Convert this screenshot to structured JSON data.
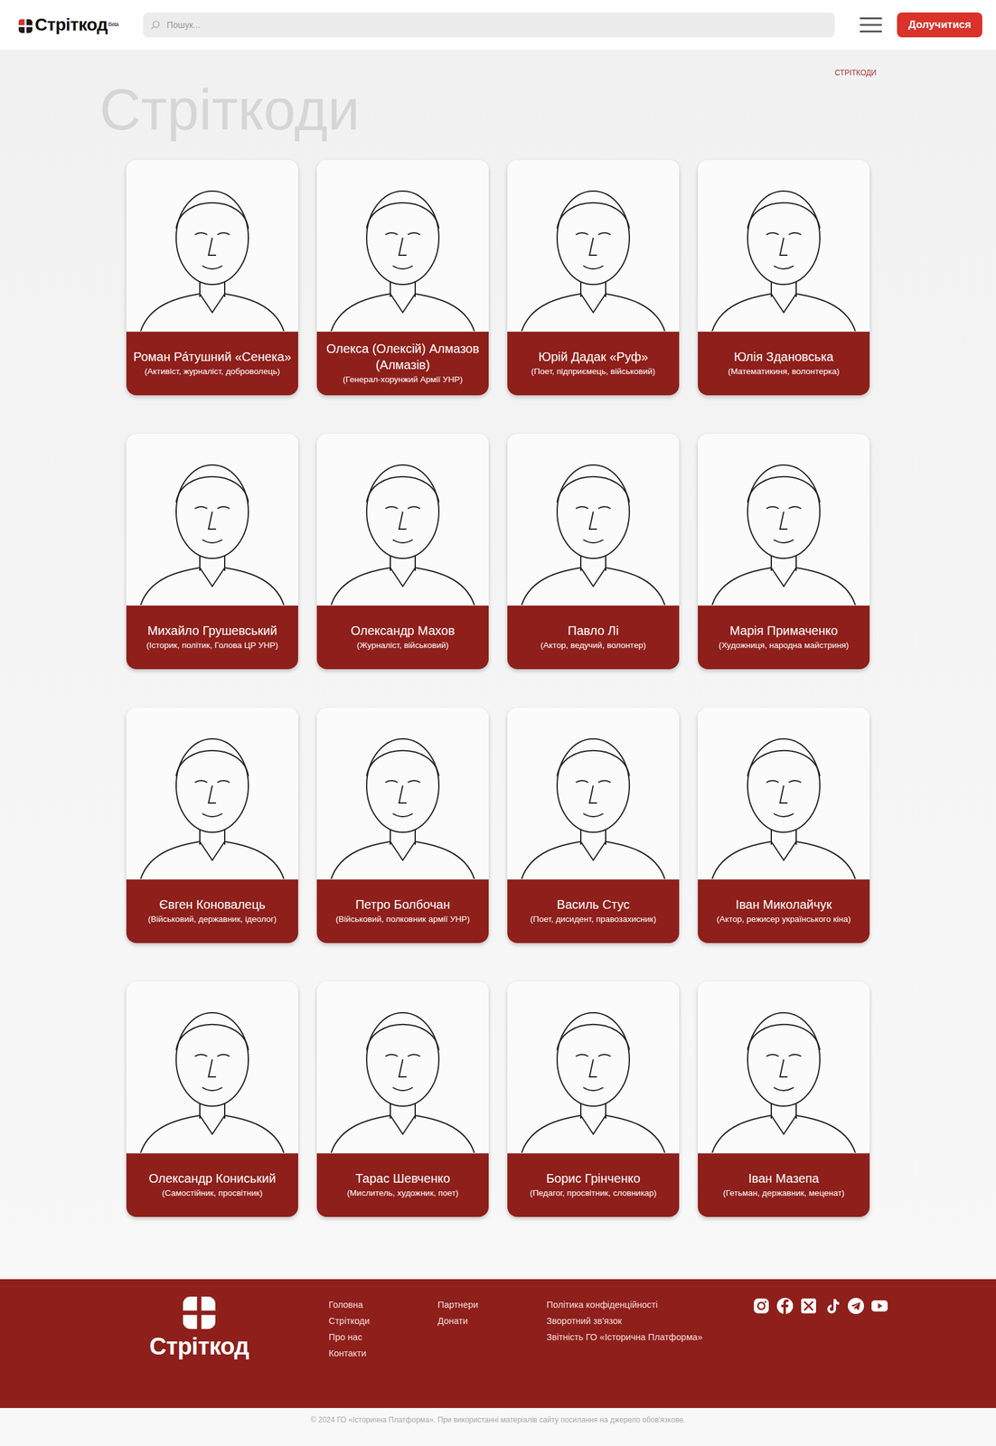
{
  "header": {
    "logo": "Стріткод",
    "beta": "Beta",
    "search": {
      "placeholder": "Пошук..."
    },
    "join_button": "Долучитися"
  },
  "breadcrumb": "СТРІТКОДИ",
  "title": "Стріткоди",
  "cards": [
    {
      "name": "Роман Ра́тушний «Сенека»",
      "role": "(Активіст, журналіст, доброволець)"
    },
    {
      "name": "Олекса (Олексій) Алмазов (Алмазів)",
      "role": "(Генерал-хорунжий Армії УНР)"
    },
    {
      "name": "Юрій Дадак «Руф»",
      "role": "(Поет, підприємець, військовий)"
    },
    {
      "name": "Юлія Здановська",
      "role": "(Математикиня, волонтерка)"
    },
    {
      "name": "Михайло Грушевський",
      "role": "(Історик, політик, Голова ЦР УНР)"
    },
    {
      "name": "Олександр Махов",
      "role": "(Журналіст, військовий)"
    },
    {
      "name": "Павло Лі",
      "role": "(Актор, ведучий, волонтер)"
    },
    {
      "name": "Марія Примаченко",
      "role": "(Художниця, народна майстриня)"
    },
    {
      "name": "Євген Коновалець",
      "role": "(Військовий, державник, ідеолог)"
    },
    {
      "name": "Петро Болбочан",
      "role": "(Військовий, полковник армії УНР)"
    },
    {
      "name": "Василь Стус",
      "role": "(Поет, дисидент, правозахисник)"
    },
    {
      "name": "Іван Миколайчук",
      "role": "(Актор, режисер українського кіна)"
    },
    {
      "name": "Олександр Кониський",
      "role": "(Самостійник, просвітник)"
    },
    {
      "name": "Тарас Шевченко",
      "role": "(Мислитель, художник, поет)"
    },
    {
      "name": "Борис Грінченко",
      "role": "(Педагог, просвітник, словникар)"
    },
    {
      "name": "Іван Мазепа",
      "role": "(Гетьман, державник, меценат)"
    }
  ],
  "footer": {
    "logo": "Стріткод",
    "columns": [
      [
        "Головна",
        "Стріткоди",
        "Про нас",
        "Контакти"
      ],
      [
        "Партнери",
        "Донати"
      ],
      [
        "Політика конфіденційності",
        "Зворотний зв'язок",
        "Звітність ГО «Історична Платформа»"
      ]
    ],
    "copyright": "© 2024 ГО «Історична Платформа». При використанні матеріалів сайту посилання на джерело обов'язкове."
  }
}
